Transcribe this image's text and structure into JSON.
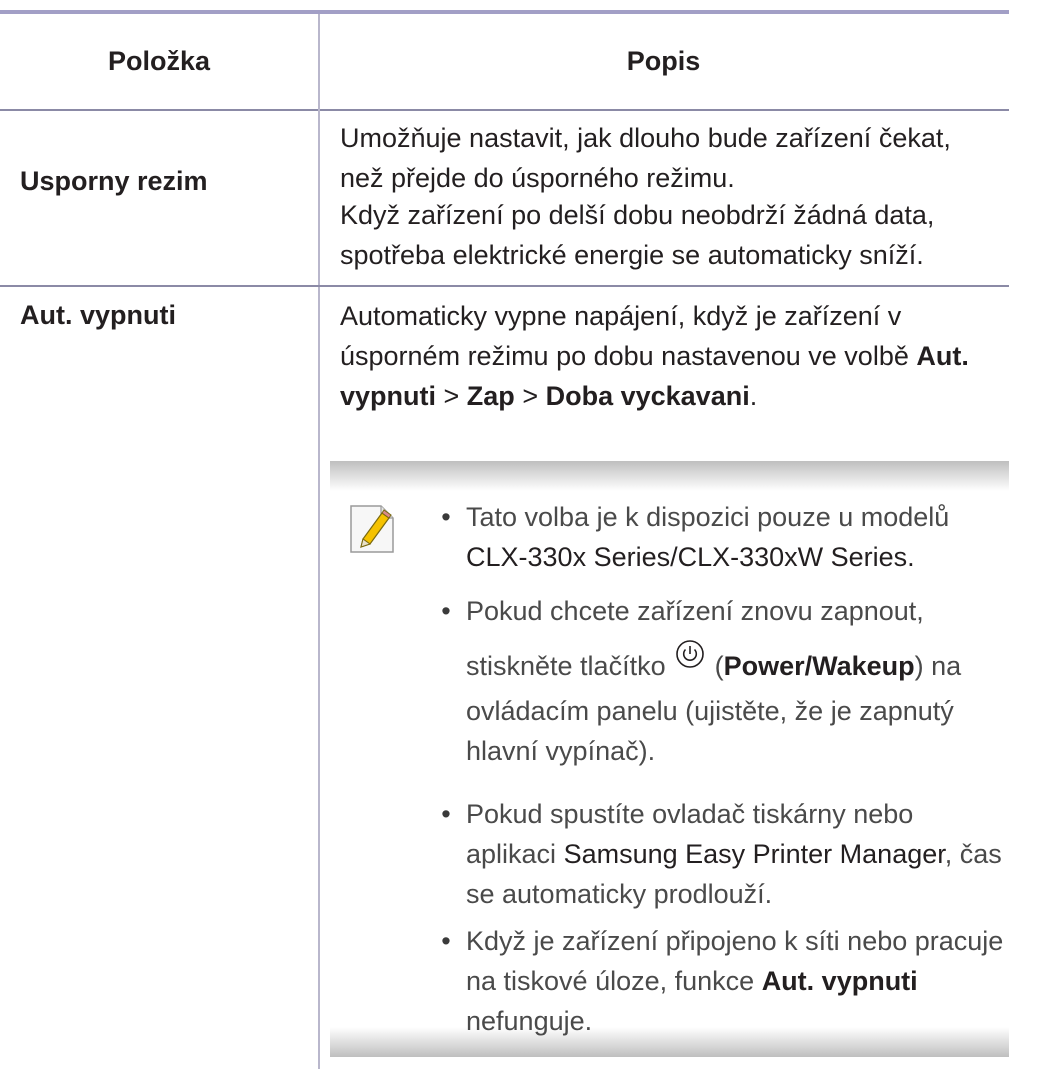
{
  "table": {
    "header_item": "Položka",
    "header_desc": "Popis"
  },
  "row1": {
    "label": "Usporny rezim",
    "desc_p1": "Umožňuje nastavit, jak dlouho bude zařízení čekat, než přejde do úsporného režimu.",
    "desc_p2": "Když zařízení po delší dobu neobdrží žádná data, spotřeba elektrické energie se automaticky sníží."
  },
  "row2": {
    "label": "Aut. vypnuti",
    "desc_text": "Automaticky vypne napájení, když je zařízení v úsporném režimu po dobu nastavenou ve volbě",
    "path_a": "Aut. vypnuti",
    "path_sep1": " > ",
    "path_b": "Zap",
    "path_sep2": " > ",
    "path_c": "Doba vyckavani",
    "path_end": "."
  },
  "note": {
    "icon": "note-pencil-icon",
    "b1_text": "Tato volba je k dispozici pouze u modelů",
    "b1_models": "CLX-330x Series/CLX-330xW Series.",
    "b2_l1": "Pokud chcete zařízení znovu zapnout,",
    "b2_l2a": "stiskněte tlačítko",
    "b2_icon": "power-icon",
    "b2_open": "(",
    "b2_btn": "Power/Wakeup",
    "b2_close": ") na",
    "b2_l3": "ovládacím panelu (ujistěte, že je zapnutý hlavní vypínač).",
    "b3_a": "Pokud spustíte ovladač tiskárny nebo aplikaci",
    "b3_app": "Samsung Easy Printer Manager",
    "b3_b": ", čas se automaticky prodlouží.",
    "b4_a": "Když je zařízení připojeno k síti nebo pracuje na tiskové úloze, funkce",
    "b4_kw": "Aut. vypnuti",
    "b4_b": "nefunguje."
  },
  "colors": {
    "header_rule": "#a29fc6",
    "row_rule": "#8b8aa6",
    "note_shade": "#bfbfbf",
    "note_icon_accent": "#f5c200"
  }
}
